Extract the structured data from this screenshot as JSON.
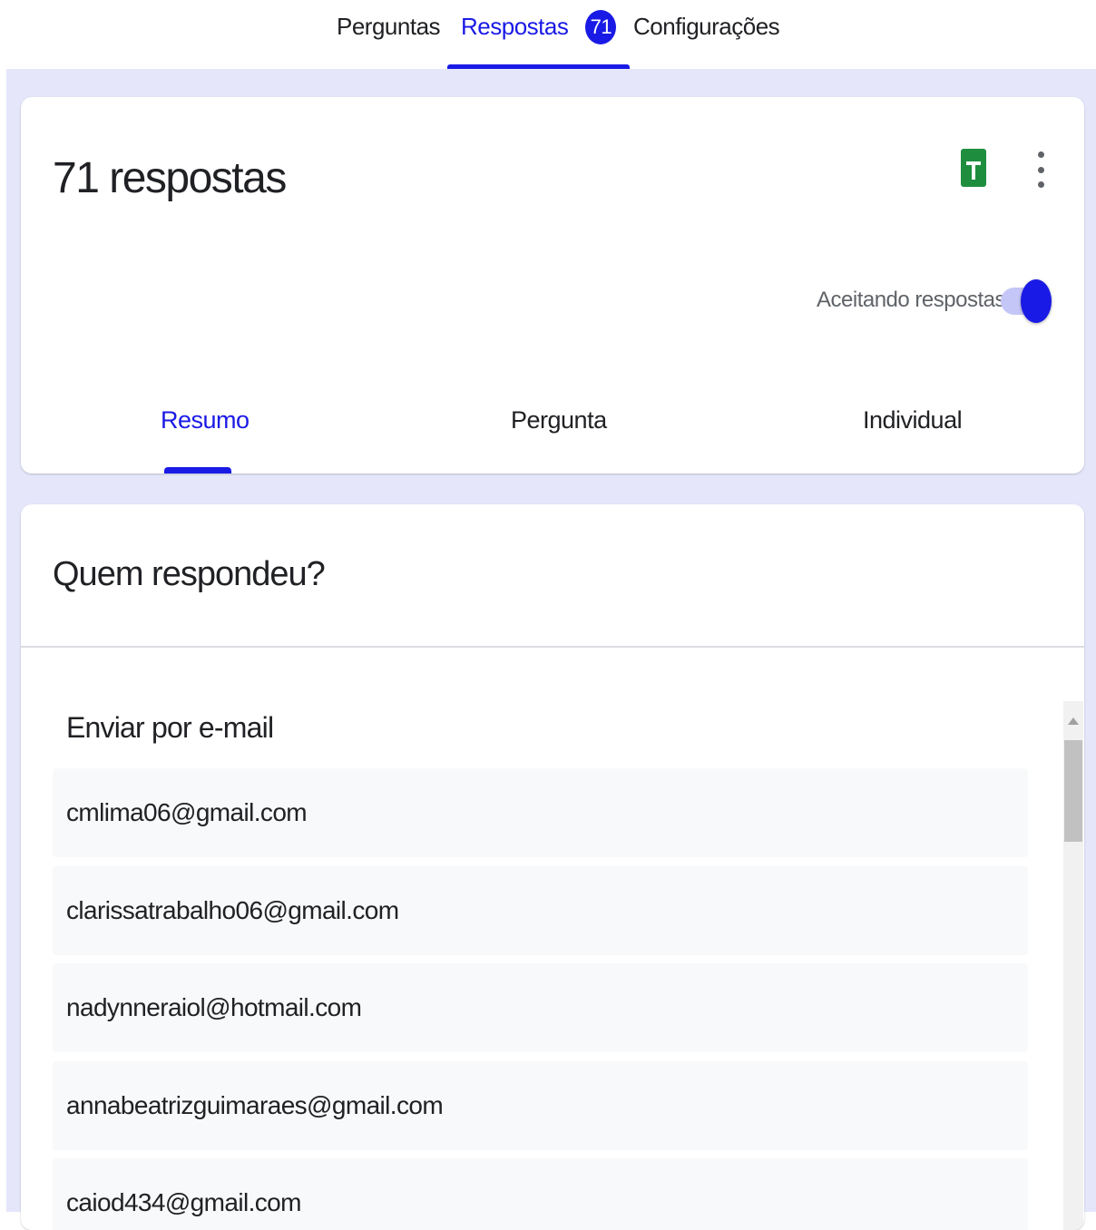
{
  "top_tabs": [
    {
      "label": "Perguntas",
      "active": false
    },
    {
      "label": "Respostas",
      "active": true,
      "badge": "71"
    },
    {
      "label": "Configurações",
      "active": false
    }
  ],
  "summary": {
    "title": "71 respostas",
    "sheets_icon": "google-sheets-icon",
    "more_icon": "more-vert-icon",
    "accepting_label": "Aceitando respostas",
    "accepting": true
  },
  "sub_tabs": [
    {
      "label": "Resumo",
      "active": true
    },
    {
      "label": "Pergunta",
      "active": false
    },
    {
      "label": "Individual",
      "active": false
    }
  ],
  "respondents": {
    "title": "Quem respondeu?",
    "list_heading": "Enviar por e-mail",
    "emails": [
      "cmlima06@gmail.com",
      "clarissatrabalho06@gmail.com",
      "nadynneraiol@hotmail.com",
      "annabeatrizguimaraes@gmail.com",
      "caiod434@gmail.com"
    ]
  },
  "colors": {
    "accent": "#1a1ae6",
    "background": "#e5e6fa",
    "sheets_green": "#1e8e3e"
  }
}
